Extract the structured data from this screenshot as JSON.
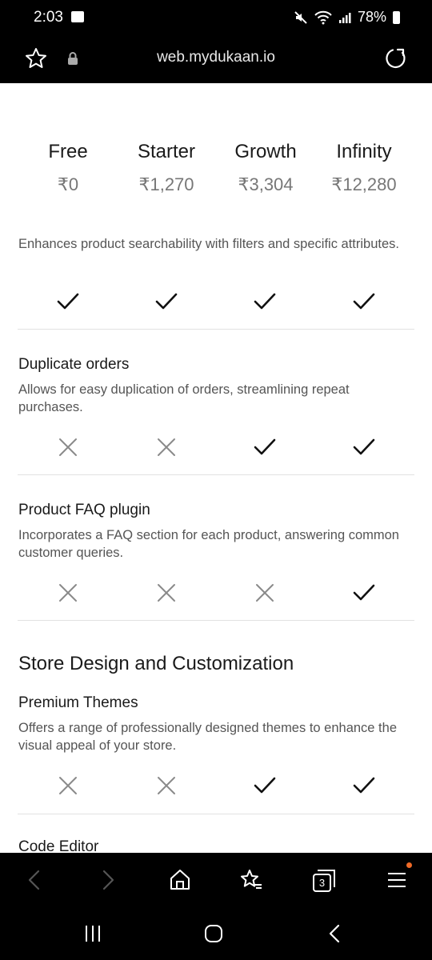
{
  "status": {
    "time": "2:03",
    "battery": "78%"
  },
  "browser": {
    "url": "web.mydukaan.io",
    "tab_count": "3"
  },
  "plans": [
    {
      "name": "Free",
      "price": "₹0"
    },
    {
      "name": "Starter",
      "price": "₹1,270"
    },
    {
      "name": "Growth",
      "price": "₹3,304"
    },
    {
      "name": "Infinity",
      "price": "₹12,280"
    }
  ],
  "features": [
    {
      "title": "",
      "description": "Enhances product searchability with filters and specific attributes.",
      "availability": [
        true,
        true,
        true,
        true
      ]
    },
    {
      "title": "Duplicate orders",
      "description": "Allows for easy duplication of orders, streamlining repeat purchases.",
      "availability": [
        false,
        false,
        true,
        true
      ]
    },
    {
      "title": "Product FAQ plugin",
      "description": "Incorporates a FAQ section for each product, answering common customer queries.",
      "availability": [
        false,
        false,
        false,
        true
      ]
    }
  ],
  "section": {
    "title": "Store Design and Customization",
    "features": [
      {
        "title": "Premium Themes",
        "description": "Offers a range of professionally designed themes to enhance the visual appeal of your store.",
        "availability": [
          false,
          false,
          true,
          true
        ]
      },
      {
        "title": "Code Editor"
      }
    ]
  },
  "colors": {
    "check": "#111111",
    "cross": "#8a8a8a",
    "accent_dot": "#f06a27"
  }
}
